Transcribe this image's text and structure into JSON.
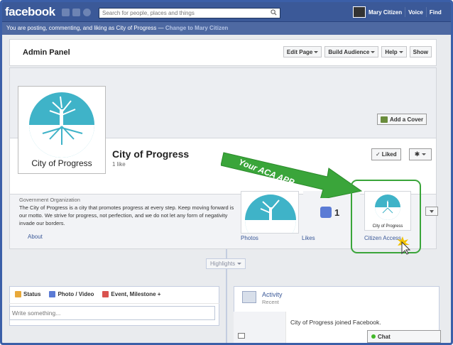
{
  "topbar": {
    "logo": "facebook",
    "search_placeholder": "Search for people, places and things",
    "user_name": "Mary Citizen",
    "voice_label": "Voice",
    "find_label": "Find"
  },
  "posting_bar": {
    "text": "You are posting, commenting, and liking as City of Progress — ",
    "change_link": "Change to Mary Citizen"
  },
  "admin_panel": {
    "title": "Admin Panel",
    "buttons": [
      "Edit Page",
      "Build Audience",
      "Help"
    ],
    "show_label": "Show"
  },
  "cover": {
    "add_cover_label": "Add a Cover"
  },
  "page": {
    "name": "City of Progress",
    "likes": "1 like",
    "liked_label": "Liked",
    "profile_text": "City of Progress"
  },
  "about": {
    "category": "Government Organization",
    "description": "The City of Progress is a city that promotes progress at every step. Keep moving forward is our motto. We strive for progress, not perfection, and we do not let any form of negativity invade our borders.",
    "link": "About"
  },
  "tiles": {
    "photos_label": "Photos",
    "likes_label": "Likes",
    "likes_count": "1",
    "citizen_label": "Citizen Access",
    "citizen_thumb_text": "City of Progress"
  },
  "callout": {
    "text": "Your ACA APP",
    "color": "#3aa53a"
  },
  "timeline": {
    "highlights_label": "Highlights",
    "composer_tabs": [
      "Status",
      "Photo / Video",
      "Event, Milestone +"
    ],
    "write_placeholder": "Write something...",
    "activity_title": "Activity",
    "activity_sub": "Recent",
    "activity_text": "City of Progress joined Facebook.",
    "chat_label": "Chat"
  },
  "colors": {
    "brand": "#3b5998",
    "teal": "#3fb3c8"
  }
}
